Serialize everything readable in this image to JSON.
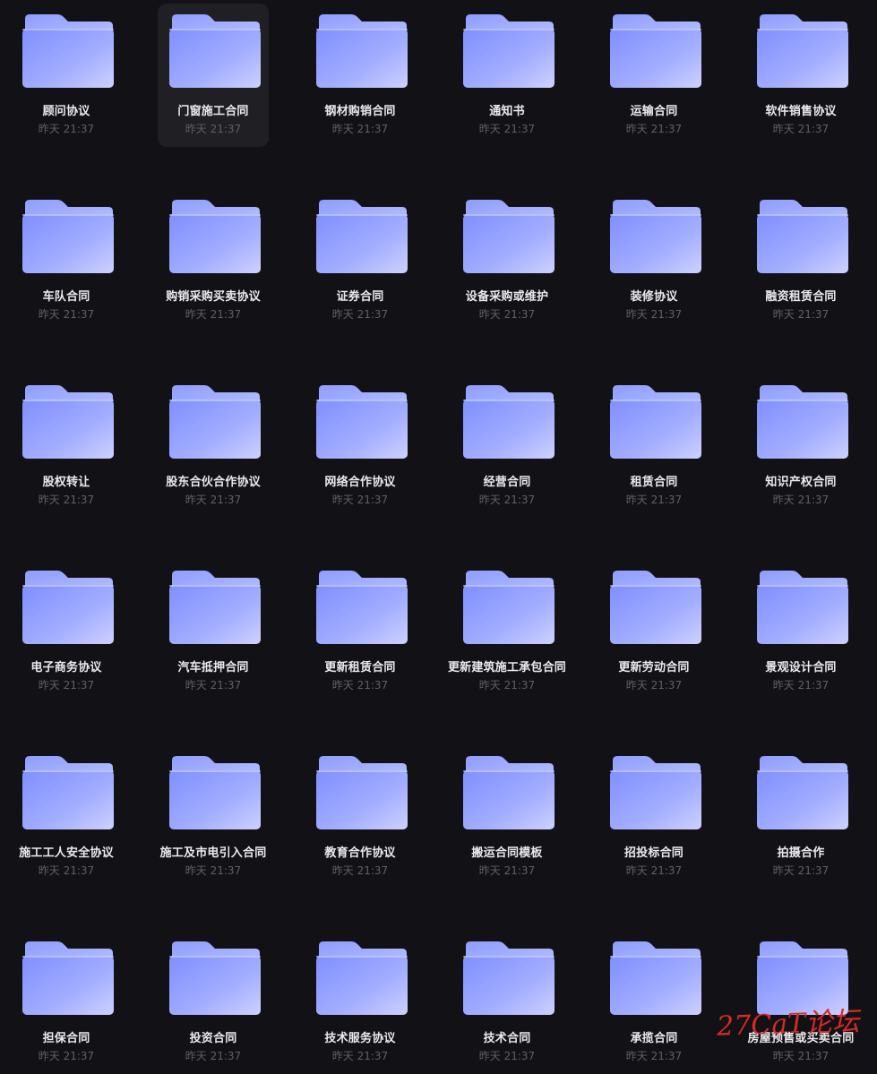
{
  "files": [
    {
      "name": "顾问协议",
      "time": "昨天 21:37",
      "selected": false
    },
    {
      "name": "门窗施工合同",
      "time": "昨天 21:37",
      "selected": true
    },
    {
      "name": "钢材购销合同",
      "time": "昨天 21:37",
      "selected": false
    },
    {
      "name": "通知书",
      "time": "昨天 21:37",
      "selected": false
    },
    {
      "name": "运输合同",
      "time": "昨天 21:37",
      "selected": false
    },
    {
      "name": "软件销售协议",
      "time": "昨天 21:37",
      "selected": false
    },
    {
      "name": "车队合同",
      "time": "昨天 21:37",
      "selected": false
    },
    {
      "name": "购销采购买卖协议",
      "time": "昨天 21:37",
      "selected": false
    },
    {
      "name": "证券合同",
      "time": "昨天 21:37",
      "selected": false
    },
    {
      "name": "设备采购或维护",
      "time": "昨天 21:37",
      "selected": false
    },
    {
      "name": "装修协议",
      "time": "昨天 21:37",
      "selected": false
    },
    {
      "name": "融资租赁合同",
      "time": "昨天 21:37",
      "selected": false
    },
    {
      "name": "股权转让",
      "time": "昨天 21:37",
      "selected": false
    },
    {
      "name": "股东合伙合作协议",
      "time": "昨天 21:37",
      "selected": false
    },
    {
      "name": "网络合作协议",
      "time": "昨天 21:37",
      "selected": false
    },
    {
      "name": "经营合同",
      "time": "昨天 21:37",
      "selected": false
    },
    {
      "name": "租赁合同",
      "time": "昨天 21:37",
      "selected": false
    },
    {
      "name": "知识产权合同",
      "time": "昨天 21:37",
      "selected": false
    },
    {
      "name": "电子商务协议",
      "time": "昨天 21:37",
      "selected": false
    },
    {
      "name": "汽车抵押合同",
      "time": "昨天 21:37",
      "selected": false
    },
    {
      "name": "更新租赁合同",
      "time": "昨天 21:37",
      "selected": false
    },
    {
      "name": "更新建筑施工承包合同",
      "time": "昨天 21:37",
      "selected": false
    },
    {
      "name": "更新劳动合同",
      "time": "昨天 21:37",
      "selected": false
    },
    {
      "name": "景观设计合同",
      "time": "昨天 21:37",
      "selected": false
    },
    {
      "name": "施工工人安全协议",
      "time": "昨天 21:37",
      "selected": false
    },
    {
      "name": "施工及市电引入合同",
      "time": "昨天 21:37",
      "selected": false
    },
    {
      "name": "教育合作协议",
      "time": "昨天 21:37",
      "selected": false
    },
    {
      "name": "搬运合同模板",
      "time": "昨天 21:37",
      "selected": false
    },
    {
      "name": "招投标合同",
      "time": "昨天 21:37",
      "selected": false
    },
    {
      "name": "拍摄合作",
      "time": "昨天 21:37",
      "selected": false
    },
    {
      "name": "担保合同",
      "time": "昨天 21:37",
      "selected": false
    },
    {
      "name": "投资合同",
      "time": "昨天 21:37",
      "selected": false
    },
    {
      "name": "技术服务协议",
      "time": "昨天 21:37",
      "selected": false
    },
    {
      "name": "技术合同",
      "time": "昨天 21:37",
      "selected": false
    },
    {
      "name": "承揽合同",
      "time": "昨天 21:37",
      "selected": false
    },
    {
      "name": "房屋预售或买卖合同",
      "time": "昨天 21:37",
      "selected": false
    }
  ],
  "icon": "folder-icon",
  "colors": {
    "background": "#121216",
    "selected_bg": "#1f1f24",
    "folder_light": "#a9b6ff",
    "folder_dark": "#7b8cff",
    "label": "#e9e9ee",
    "time": "#5f5f66",
    "watermark": "#d62a24"
  },
  "watermark": "27CaT论坛"
}
